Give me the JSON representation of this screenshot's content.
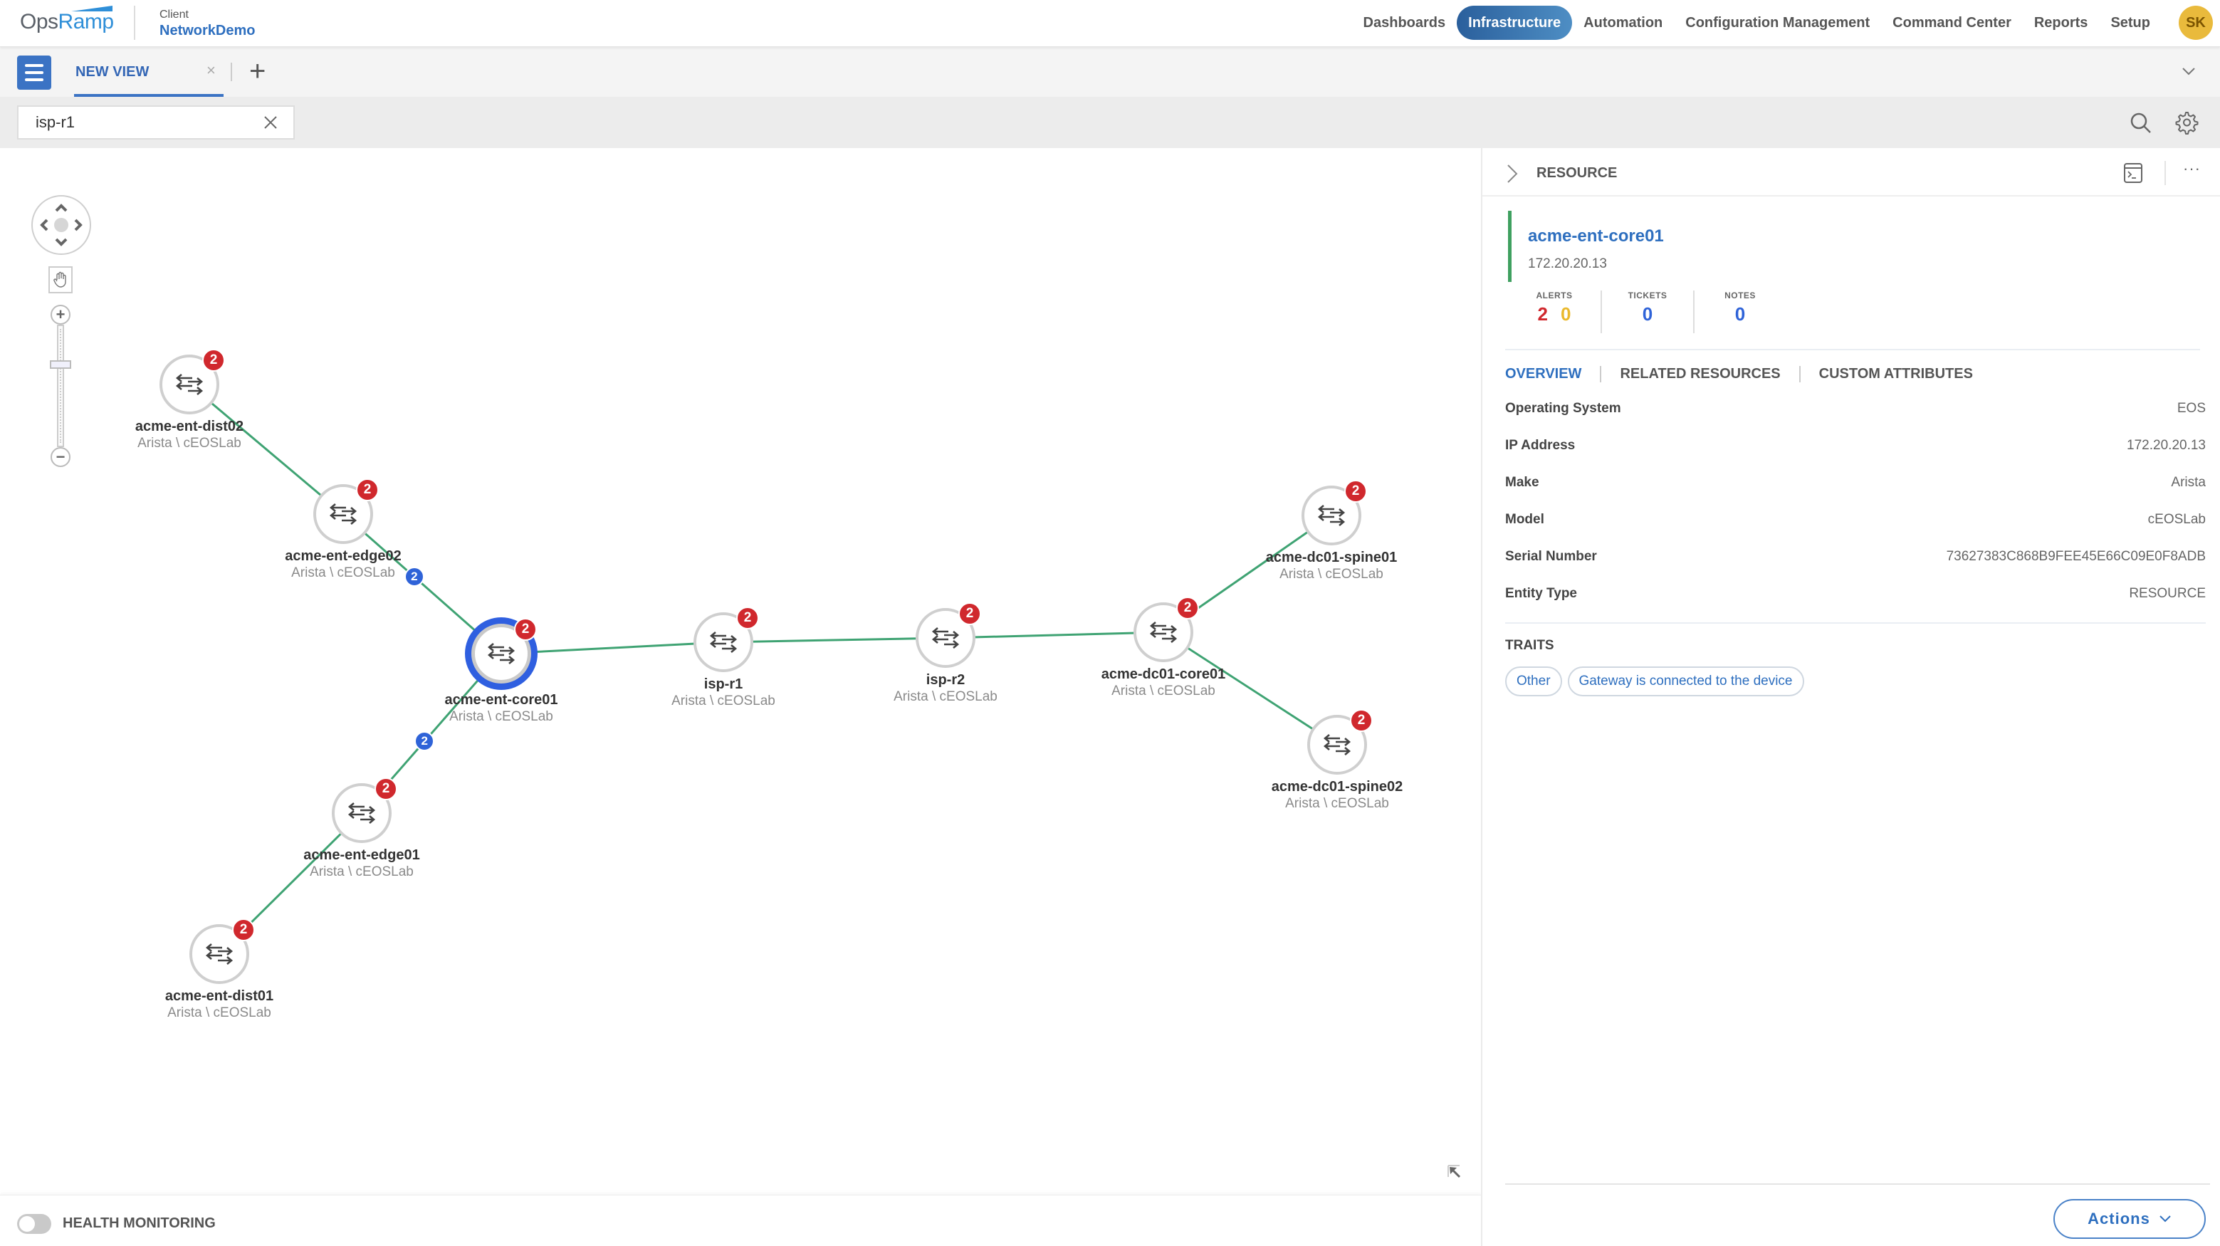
{
  "header": {
    "logo_ops": "Ops",
    "logo_ramp": "Ramp",
    "client_label": "Client",
    "client_name": "NetworkDemo",
    "nav": [
      {
        "label": "Dashboards",
        "active": false
      },
      {
        "label": "Infrastructure",
        "active": true
      },
      {
        "label": "Automation",
        "active": false
      },
      {
        "label": "Configuration Management",
        "active": false
      },
      {
        "label": "Command Center",
        "active": false
      },
      {
        "label": "Reports",
        "active": false
      },
      {
        "label": "Setup",
        "active": false
      }
    ],
    "user_initials": "SK"
  },
  "tabs": {
    "items": [
      {
        "label": "NEW VIEW",
        "active": true
      }
    ],
    "close_glyph": "×",
    "add_glyph": "+"
  },
  "search": {
    "value": "isp-r1",
    "placeholder": ""
  },
  "topology": {
    "nodes": [
      {
        "id": "dist02",
        "name": "acme-ent-dist02",
        "sub": "Arista \\ cEOSLab",
        "alerts": "2",
        "selected": false
      },
      {
        "id": "edge02",
        "name": "acme-ent-edge02",
        "sub": "Arista \\ cEOSLab",
        "alerts": "2",
        "selected": false
      },
      {
        "id": "core01",
        "name": "acme-ent-core01",
        "sub": "Arista \\ cEOSLab",
        "alerts": "2",
        "selected": true
      },
      {
        "id": "edge01",
        "name": "acme-ent-edge01",
        "sub": "Arista \\ cEOSLab",
        "alerts": "2",
        "selected": false
      },
      {
        "id": "dist01",
        "name": "acme-ent-dist01",
        "sub": "Arista \\ cEOSLab",
        "alerts": "2",
        "selected": false
      },
      {
        "id": "ispr1",
        "name": "isp-r1",
        "sub": "Arista \\ cEOSLab",
        "alerts": "2",
        "selected": false
      },
      {
        "id": "ispr2",
        "name": "isp-r2",
        "sub": "Arista \\ cEOSLab",
        "alerts": "2",
        "selected": false
      },
      {
        "id": "dccore",
        "name": "acme-dc01-core01",
        "sub": "Arista \\ cEOSLab",
        "alerts": "2",
        "selected": false
      },
      {
        "id": "spine01",
        "name": "acme-dc01-spine01",
        "sub": "Arista \\ cEOSLab",
        "alerts": "2",
        "selected": false
      },
      {
        "id": "spine02",
        "name": "acme-dc01-spine02",
        "sub": "Arista \\ cEOSLab",
        "alerts": "2",
        "selected": false
      }
    ],
    "links": [
      {
        "from": "dist02",
        "to": "edge02",
        "count": null
      },
      {
        "from": "edge02",
        "to": "core01",
        "count": "2"
      },
      {
        "from": "core01",
        "to": "edge01",
        "count": "2"
      },
      {
        "from": "edge01",
        "to": "dist01",
        "count": null
      },
      {
        "from": "core01",
        "to": "ispr1",
        "count": null
      },
      {
        "from": "ispr1",
        "to": "ispr2",
        "count": null
      },
      {
        "from": "ispr2",
        "to": "dccore",
        "count": null
      },
      {
        "from": "dccore",
        "to": "spine01",
        "count": null
      },
      {
        "from": "dccore",
        "to": "spine02",
        "count": null
      }
    ],
    "zoom_level_fraction": 0.3,
    "link_color": "#3fa373",
    "alert_color": "#d0282d",
    "selected_ring_color": "#2f5fe0"
  },
  "footer": {
    "health_monitoring_label": "HEALTH MONITORING",
    "health_monitoring_on": false
  },
  "panel": {
    "title": "RESOURCE",
    "more_glyph": "···",
    "resource_name": "acme-ent-core01",
    "resource_ip": "172.20.20.13",
    "stats": {
      "alerts_label": "ALERTS",
      "alerts_critical": "2",
      "alerts_warning": "0",
      "tickets_label": "TICKETS",
      "tickets": "0",
      "notes_label": "NOTES",
      "notes": "0"
    },
    "tabs": [
      {
        "label": "OVERVIEW",
        "active": true
      },
      {
        "label": "RELATED RESOURCES",
        "active": false
      },
      {
        "label": "CUSTOM ATTRIBUTES",
        "active": false
      }
    ],
    "properties": [
      {
        "key": "Operating System",
        "value": "EOS"
      },
      {
        "key": "IP Address",
        "value": "172.20.20.13"
      },
      {
        "key": "Make",
        "value": "Arista"
      },
      {
        "key": "Model",
        "value": "cEOSLab"
      },
      {
        "key": "Serial Number",
        "value": "73627383C868B9FEE45E66C09E0F8ADB"
      },
      {
        "key": "Entity Type",
        "value": "RESOURCE"
      }
    ],
    "traits_title": "TRAITS",
    "traits": [
      "Other",
      "Gateway is connected to the device"
    ],
    "actions_label": "Actions"
  }
}
